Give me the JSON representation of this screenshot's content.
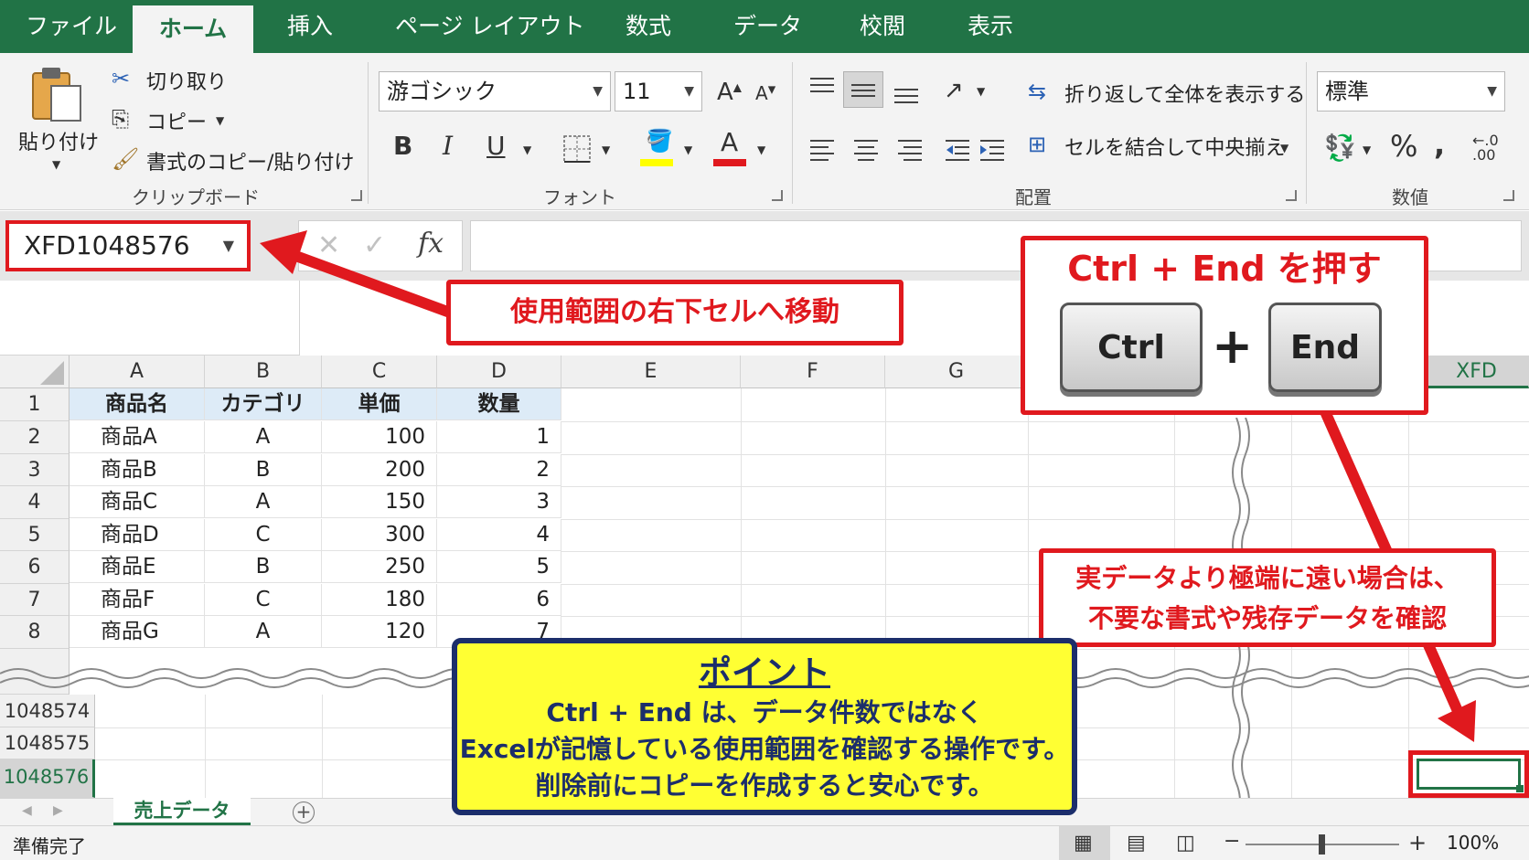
{
  "tabs": [
    "ファイル",
    "ホーム",
    "挿入",
    "ページ レイアウト",
    "数式",
    "データ",
    "校閲",
    "表示"
  ],
  "active_tab": "ホーム",
  "ribbon": {
    "clipboard": {
      "paste": "貼り付け",
      "cut": "切り取り",
      "copy": "コピー",
      "format_painter": "書式のコピー/貼り付け",
      "label": "クリップボード"
    },
    "font": {
      "name": "游ゴシック",
      "size": "11",
      "label": "フォント",
      "bold": "B",
      "italic": "I",
      "underline": "U",
      "font_color_letter": "A",
      "grow_letter": "A",
      "shrink_letter": "A"
    },
    "alignment": {
      "wrap": "折り返して全体を表示する",
      "merge": "セルを結合して中央揃え",
      "label": "配置"
    },
    "number": {
      "format": "標準",
      "percent": "%",
      "comma": ",",
      "label": "数値"
    }
  },
  "name_box": "XFD1048576",
  "fx_label": "fx",
  "columns": [
    "A",
    "B",
    "C",
    "D",
    "E",
    "F",
    "G",
    "XFD"
  ],
  "rows": [
    {
      "num": "1",
      "cells": [
        "商品名",
        "カテゴリ",
        "単価",
        "数量"
      ]
    },
    {
      "num": "2",
      "cells": [
        "商品A",
        "A",
        "100",
        "1"
      ]
    },
    {
      "num": "3",
      "cells": [
        "商品B",
        "B",
        "200",
        "2"
      ]
    },
    {
      "num": "4",
      "cells": [
        "商品C",
        "A",
        "150",
        "3"
      ]
    },
    {
      "num": "5",
      "cells": [
        "商品D",
        "C",
        "300",
        "4"
      ]
    },
    {
      "num": "6",
      "cells": [
        "商品E",
        "B",
        "250",
        "5"
      ]
    },
    {
      "num": "7",
      "cells": [
        "商品F",
        "C",
        "180",
        "6"
      ]
    },
    {
      "num": "8",
      "cells": [
        "商品G",
        "A",
        "120",
        "7"
      ]
    }
  ],
  "bottom_rows": [
    "1048574",
    "1048575",
    "1048576"
  ],
  "sheet_tab": "売上データ",
  "status": "準備完了",
  "zoom": "100%",
  "callouts": {
    "move": "使用範囲の右下セルへ移動",
    "title": "Ctrl + End を押す",
    "key1": "Ctrl",
    "plus": "+",
    "key2": "End",
    "warning_line1": "実データより極端に遠い場合は、",
    "warning_line2": "不要な書式や残存データを確認"
  },
  "point": {
    "heading": "ポイント",
    "line1": "Ctrl + End は、データ件数ではなく",
    "line2": "Excelが記憶している使用範囲を確認する操作です。",
    "line3": "削除前にコピーを作成すると安心です。"
  },
  "colors": {
    "excel_green": "#217346",
    "callout_red": "#e0191e",
    "point_yellow": "#ffff33",
    "point_navy": "#1c2e6b",
    "header_fill": "#ddebf7"
  }
}
